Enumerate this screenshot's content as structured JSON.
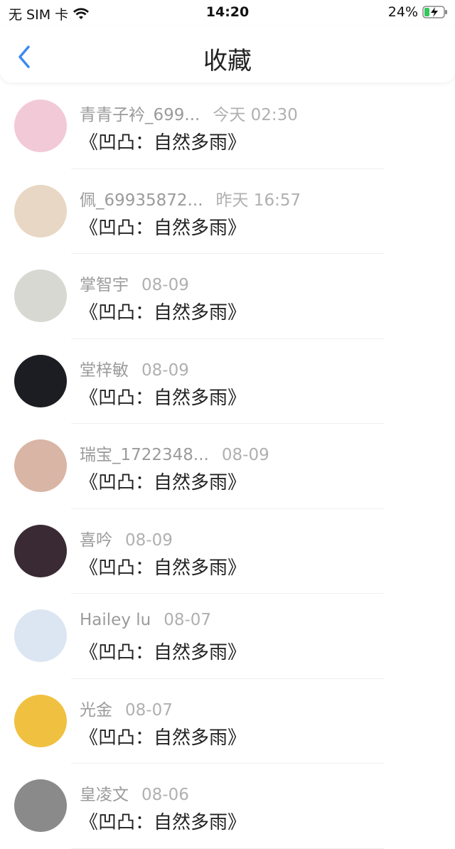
{
  "status": {
    "carrier": "无 SIM 卡",
    "time": "14:20",
    "battery": "24%"
  },
  "nav": {
    "title": "收藏",
    "back_icon": "chevron-left-icon"
  },
  "items": [
    {
      "name": "青青子衿_699...",
      "time": "今天 02:30",
      "title": "《凹凸：自然多雨》",
      "avatar_color": "#f2c9d6"
    },
    {
      "name": "佩_69935872...",
      "time": "昨天 16:57",
      "title": "《凹凸：自然多雨》",
      "avatar_color": "#e8d7c4"
    },
    {
      "name": "掌智宇",
      "time": "08-09",
      "title": "《凹凸：自然多雨》",
      "avatar_color": "#d8d8d2"
    },
    {
      "name": "堂梓敏",
      "time": "08-09",
      "title": "《凹凸：自然多雨》",
      "avatar_color": "#1b1d22"
    },
    {
      "name": "瑞宝_1722348...",
      "time": "08-09",
      "title": "《凹凸：自然多雨》",
      "avatar_color": "#d9b5a5"
    },
    {
      "name": "喜吟",
      "time": "08-09",
      "title": "《凹凸：自然多雨》",
      "avatar_color": "#3a2a33"
    },
    {
      "name": "Hailey lu",
      "time": "08-07",
      "title": "《凹凸：自然多雨》",
      "avatar_color": "#dbe6f2"
    },
    {
      "name": "光金",
      "time": "08-07",
      "title": "《凹凸：自然多雨》",
      "avatar_color": "#f0c040"
    },
    {
      "name": "皇凌文",
      "time": "08-06",
      "title": "《凹凸：自然多雨》",
      "avatar_color": "#8a8a8a"
    }
  ]
}
